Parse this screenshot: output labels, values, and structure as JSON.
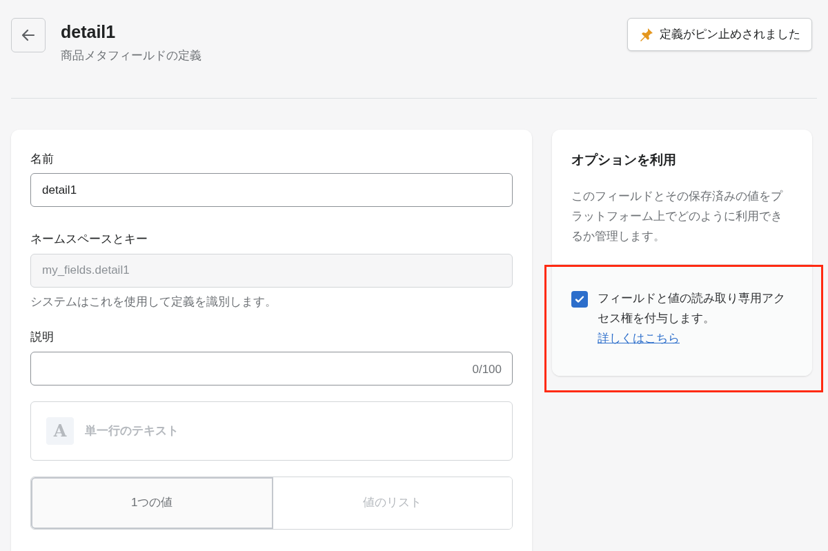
{
  "header": {
    "title": "detail1",
    "subtitle": "商品メタフィールドの定義",
    "pin_button": "定義がピン止めされました"
  },
  "form": {
    "name": {
      "label": "名前",
      "value": "detail1"
    },
    "namespace": {
      "label": "ネームスペースとキー",
      "placeholder": "my_fields.detail1",
      "disabled": true,
      "help": "システムはこれを使用して定義を識別します。"
    },
    "description": {
      "label": "説明",
      "counter": "0/100"
    },
    "type": {
      "icon_letter": "A",
      "label": "単一行のテキスト",
      "disabled": true
    },
    "value_modes": [
      {
        "label": "1つの値",
        "selected": true
      },
      {
        "label": "値のリスト",
        "selected": false
      }
    ]
  },
  "options": {
    "title": "オプションを利用",
    "description": "このフィールドとその保存済みの値をプラットフォーム上でどのように利用できるか管理します。",
    "highlighted": true,
    "access": {
      "checked": true,
      "text": "フィールドと値の読み取り専用アクセス権を付与します。",
      "link": "詳しくはこちら"
    }
  }
}
